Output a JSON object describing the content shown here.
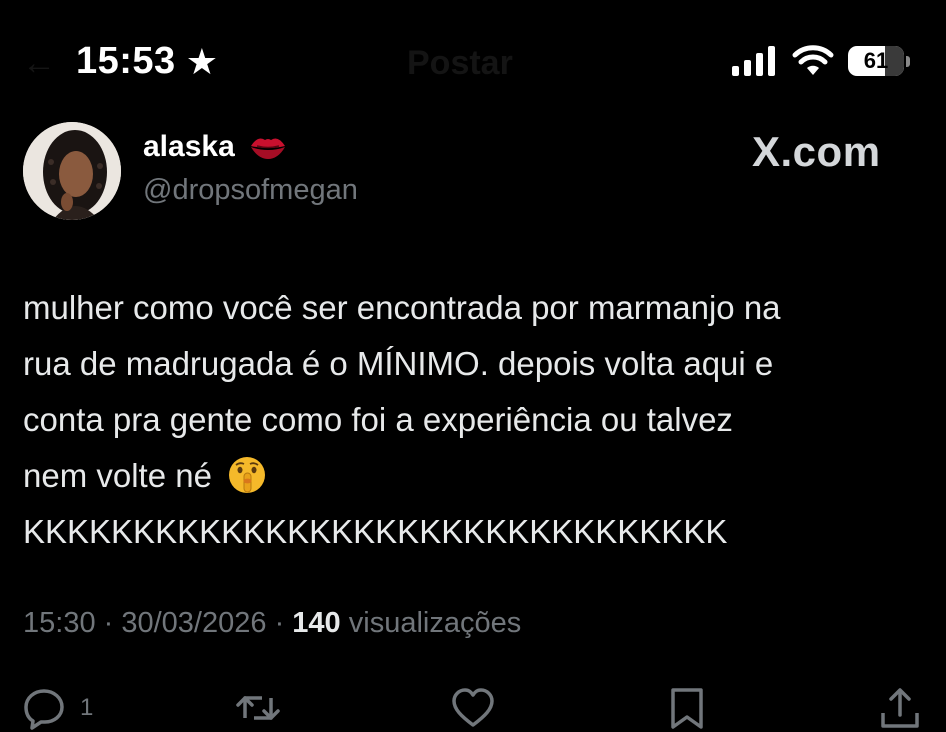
{
  "status_bar": {
    "time": "15:53",
    "battery_level": "61"
  },
  "header": {
    "title": "Postar"
  },
  "author": {
    "name": "alaska",
    "handle": "@dropsofmegan"
  },
  "brand": "X.com",
  "tweet": {
    "lines": [
      "mulher como você ser encontrada por marmanjo na",
      "rua de madrugada é o MÍNIMO. depois volta aqui e",
      "conta pra gente como foi a experiência ou talvez",
      "nem volte né",
      "KKKKKKKKKKKKKKKKKKKKKKKKKKKKKKKK"
    ]
  },
  "meta": {
    "time": "15:30",
    "separator1": " · ",
    "date": "30/03/2026",
    "separator2": " · ",
    "views_count": "140",
    "views_label": " visualizações"
  },
  "actions": {
    "reply_count": "1"
  },
  "icons": {
    "status_star": "star-icon",
    "signal": "cellular-signal-icon",
    "wifi": "wifi-icon",
    "battery": "battery-icon",
    "name_emoji": "kiss-lips-icon",
    "text_emoji": "shushing-face-icon",
    "reply": "reply-icon",
    "repost": "repost-icon",
    "like": "heart-icon",
    "bookmark": "bookmark-icon",
    "share": "share-icon"
  },
  "colors": {
    "background": "#000000",
    "text": "#e7e9ea",
    "secondary_text": "#71767b",
    "emoji_red": "#c8102e",
    "emoji_yellow": "#f5b92a"
  }
}
